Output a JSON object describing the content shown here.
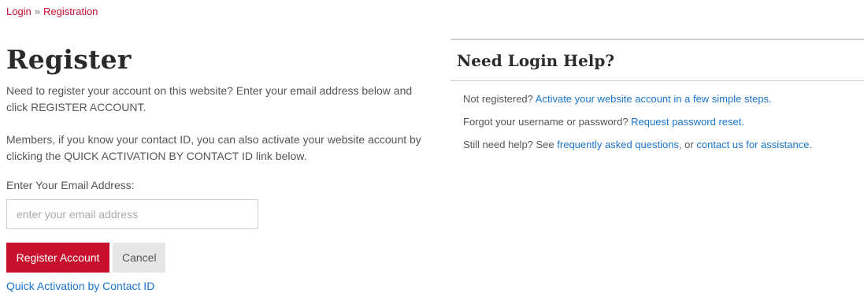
{
  "breadcrumb": {
    "login": "Login",
    "separator": "»",
    "current": "Registration"
  },
  "register": {
    "title": "Register",
    "intro1": "Need to register your account on this website? Enter your email address below and click REGISTER ACCOUNT.",
    "intro2": "Members, if you know your contact ID, you can also activate your website account by clicking the QUICK ACTIVATION BY CONTACT ID link below.",
    "email_label": "Enter Your Email Address:",
    "email_placeholder": "enter your email address",
    "email_value": "",
    "register_button": "Register Account",
    "cancel_button": "Cancel",
    "quick_activation_link": "Quick Activation by Contact ID"
  },
  "help": {
    "title": "Need Login Help?",
    "line1_text": "Not registered?",
    "line1_link": "Activate your website account in a few simple steps.",
    "line2_text": "Forgot your username or password?",
    "line2_link": "Request password reset.",
    "line3_text": "Still need help? See",
    "line3_link1": "frequently asked questions",
    "line3_mid": ", or",
    "line3_link2": "contact us for assistance."
  },
  "colors": {
    "accent": "#c8102e",
    "link": "#1a73c9"
  }
}
